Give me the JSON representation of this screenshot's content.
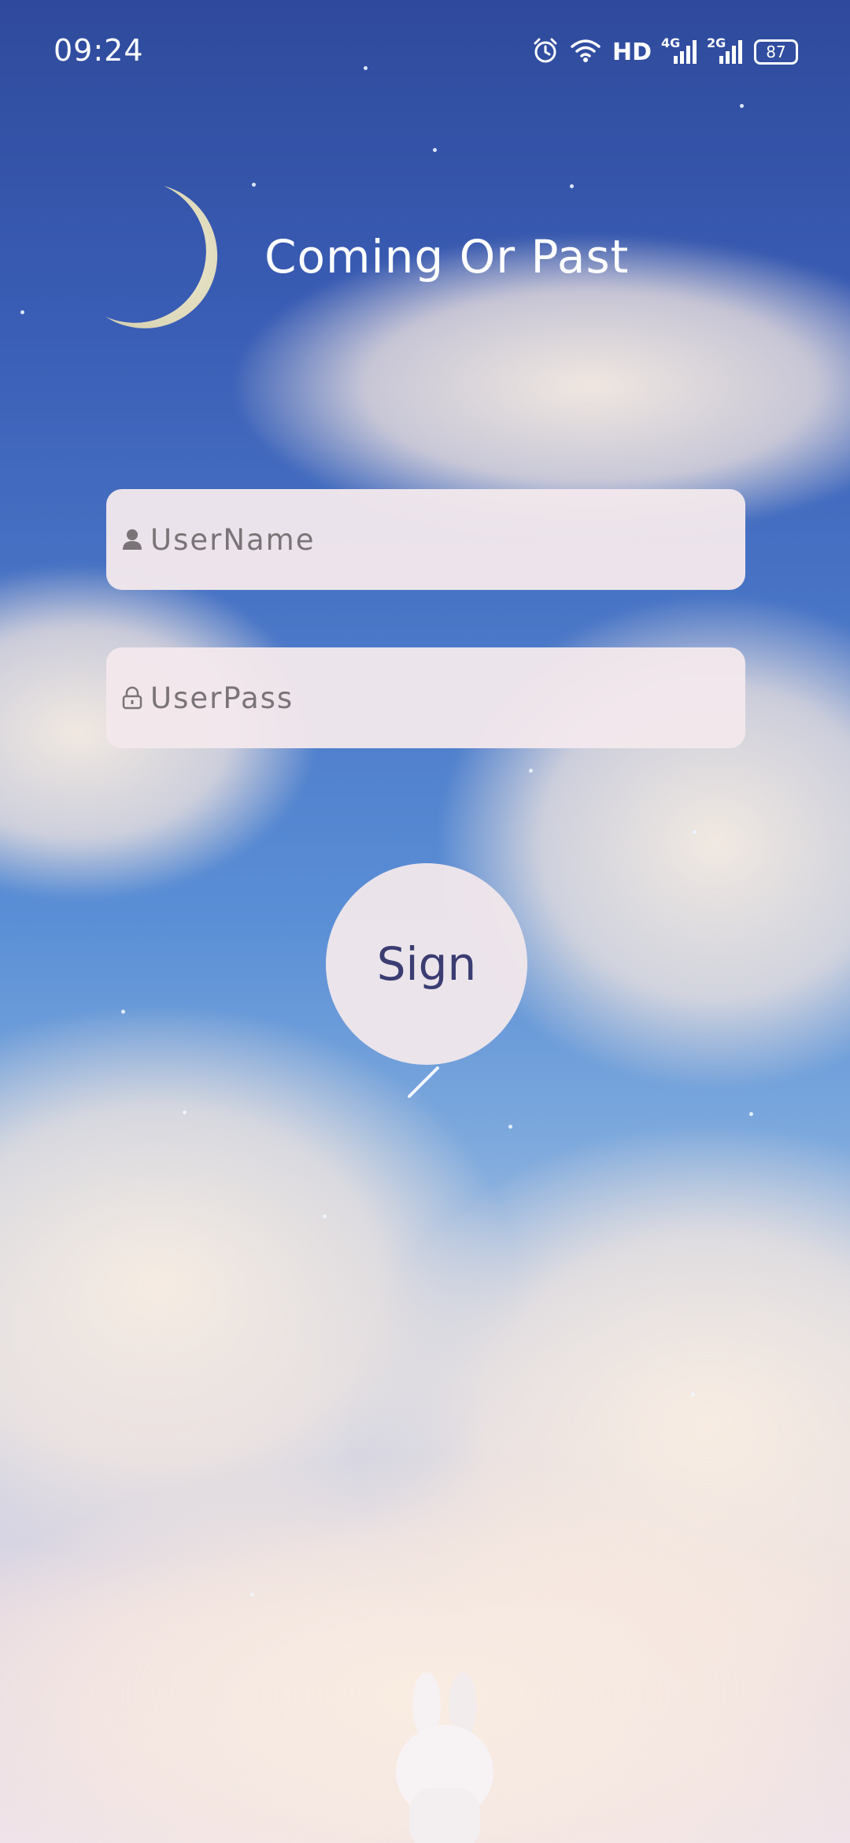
{
  "status_bar": {
    "time": "09:24",
    "network_label": "HD",
    "signal1_tag": "4G",
    "signal2_tag": "2G",
    "battery_level": "87"
  },
  "header": {
    "title": "Coming Or Past"
  },
  "form": {
    "username_placeholder": "UserName",
    "password_placeholder": "UserPass",
    "sign_label": "Sign"
  },
  "icons": {
    "alarm": "alarm-icon",
    "wifi": "wifi-icon",
    "user": "user-icon",
    "lock": "lock-icon",
    "moon": "moon-icon"
  },
  "colors": {
    "sign_text": "#3a3c72",
    "field_bg": "#f2e8ec",
    "sky_top": "#2f4a9c"
  }
}
